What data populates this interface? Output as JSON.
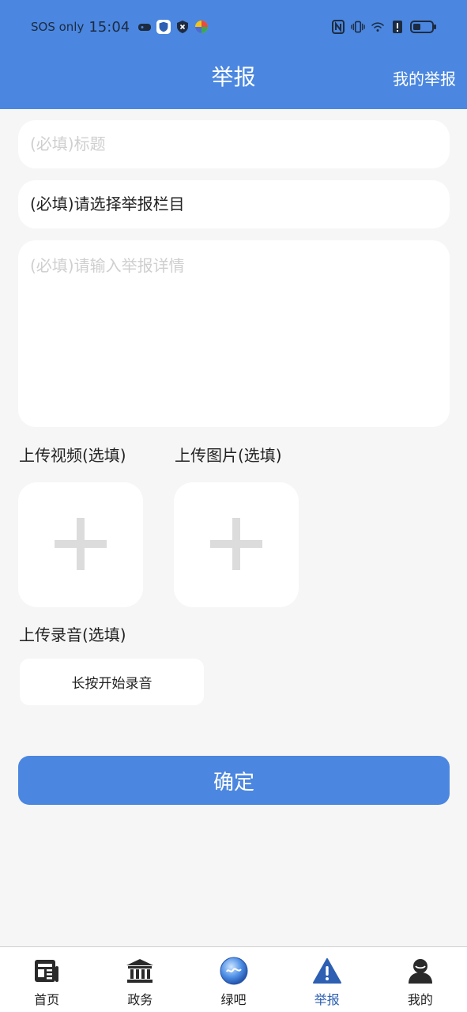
{
  "status_bar": {
    "sos": "SOS only",
    "time": "15:04"
  },
  "header": {
    "title": "举报",
    "my_reports": "我的举报"
  },
  "form": {
    "title_placeholder": "(必填)标题",
    "category_value": "(必填)请选择举报栏目",
    "detail_placeholder": "(必填)请输入举报详情",
    "upload_video_label": "上传视频(选填)",
    "upload_image_label": "上传图片(选填)",
    "upload_audio_label": "上传录音(选填)",
    "record_button": "长按开始录音",
    "confirm_button": "确定"
  },
  "bottom_nav": {
    "items": [
      {
        "label": "首页",
        "icon": "news-icon"
      },
      {
        "label": "政务",
        "icon": "government-building-icon"
      },
      {
        "label": "绿吧",
        "icon": "lvba-logo-icon"
      },
      {
        "label": "举报",
        "icon": "warning-icon",
        "active": true
      },
      {
        "label": "我的",
        "icon": "user-icon"
      }
    ]
  },
  "colors": {
    "primary": "#4b87e0",
    "active_nav": "#2d5fb3",
    "background": "#f6f6f6"
  }
}
